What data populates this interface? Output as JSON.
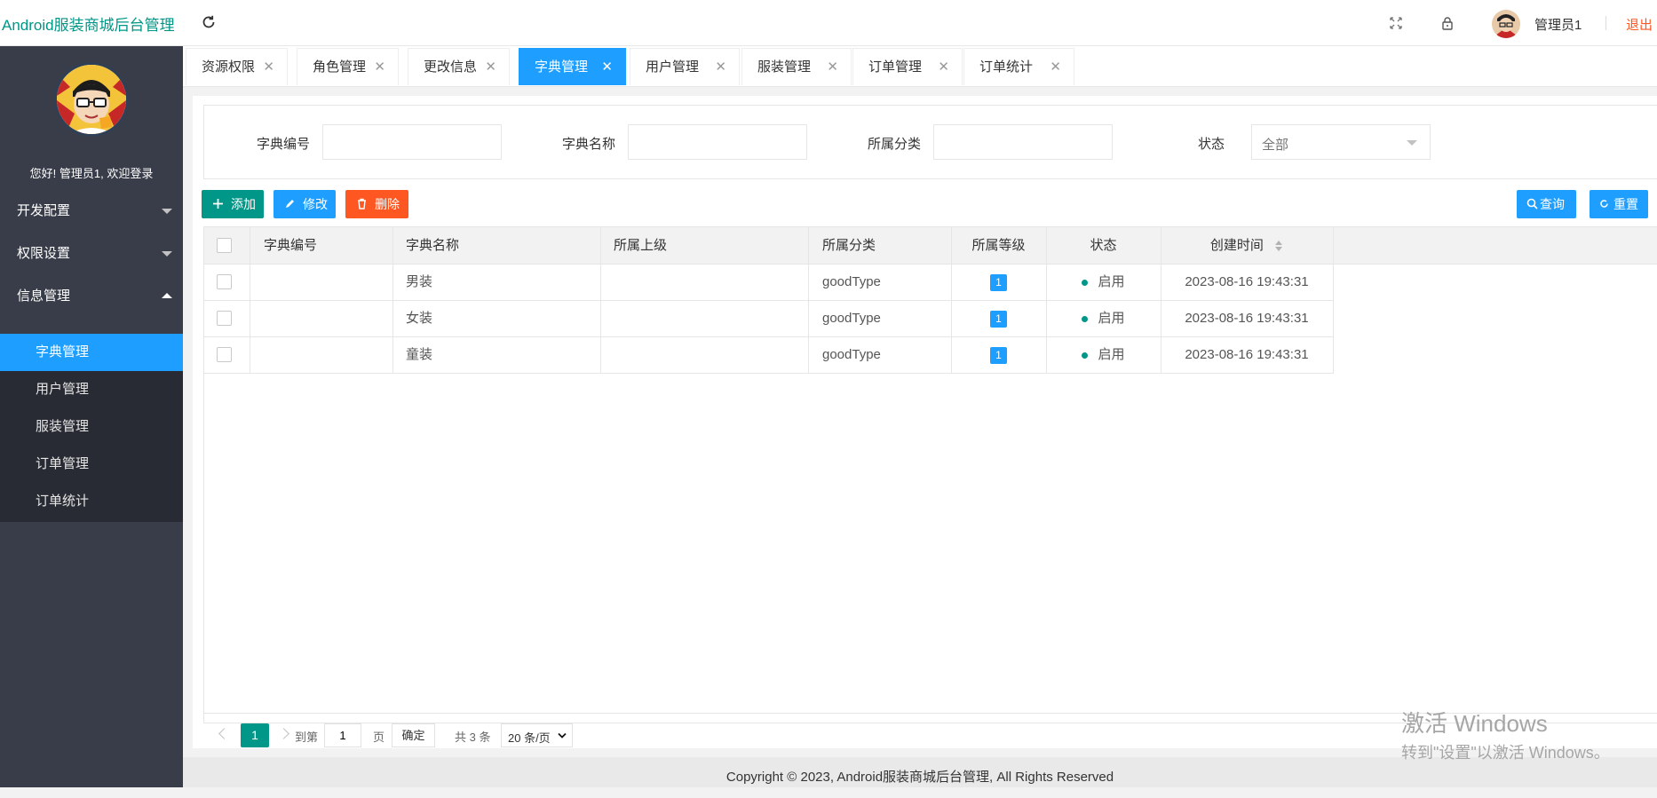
{
  "header": {
    "brand": "Android服装商城后台管理",
    "user_name": "管理员1",
    "logout": "退出"
  },
  "sidebar": {
    "welcome": "您好! 管理员1, 欢迎登录",
    "groups": [
      {
        "label": "开发配置",
        "expanded": false
      },
      {
        "label": "权限设置",
        "expanded": false
      },
      {
        "label": "信息管理",
        "expanded": true
      }
    ],
    "sub_items": [
      {
        "label": "字典管理",
        "active": true
      },
      {
        "label": "用户管理",
        "active": false
      },
      {
        "label": "服装管理",
        "active": false
      },
      {
        "label": "订单管理",
        "active": false
      },
      {
        "label": "订单统计",
        "active": false
      }
    ]
  },
  "tabs": [
    {
      "label": "资源权限",
      "active": false
    },
    {
      "label": "角色管理",
      "active": false
    },
    {
      "label": "更改信息",
      "active": false
    },
    {
      "label": "字典管理",
      "active": true
    },
    {
      "label": "用户管理",
      "active": false
    },
    {
      "label": "服装管理",
      "active": false
    },
    {
      "label": "订单管理",
      "active": false
    },
    {
      "label": "订单统计",
      "active": false
    }
  ],
  "filters": {
    "code_label": "字典编号",
    "code_value": "",
    "name_label": "字典名称",
    "name_value": "",
    "category_label": "所属分类",
    "category_value": "",
    "status_label": "状态",
    "status_value": "全部"
  },
  "toolbar": {
    "add": "添加",
    "edit": "修改",
    "delete": "删除",
    "query": "查询",
    "reset": "重置"
  },
  "table": {
    "headers": [
      "字典编号",
      "字典名称",
      "所属上级",
      "所属分类",
      "所属等级",
      "状态",
      "创建时间"
    ],
    "rows": [
      {
        "code": "",
        "name": "男装",
        "parent": "",
        "category": "goodType",
        "level": "1",
        "status": "启用",
        "created": "2023-08-16 19:43:31"
      },
      {
        "code": "",
        "name": "女装",
        "parent": "",
        "category": "goodType",
        "level": "1",
        "status": "启用",
        "created": "2023-08-16 19:43:31"
      },
      {
        "code": "",
        "name": "童装",
        "parent": "",
        "category": "goodType",
        "level": "1",
        "status": "启用",
        "created": "2023-08-16 19:43:31"
      }
    ]
  },
  "pager": {
    "current": "1",
    "goto_label": "到第",
    "goto_value": "1",
    "page_unit": "页",
    "confirm": "确定",
    "total": "共 3 条",
    "page_size": "20 条/页"
  },
  "footer": "Copyright © 2023, Android服装商城后台管理, All Rights Reserved",
  "watermark": {
    "line1": "激活 Windows",
    "line2": "转到\"设置\"以激活 Windows。"
  },
  "colors": {
    "accent": "#009688",
    "blue": "#1e9fff",
    "danger": "#ff5722",
    "sidebar": "#393d49"
  }
}
